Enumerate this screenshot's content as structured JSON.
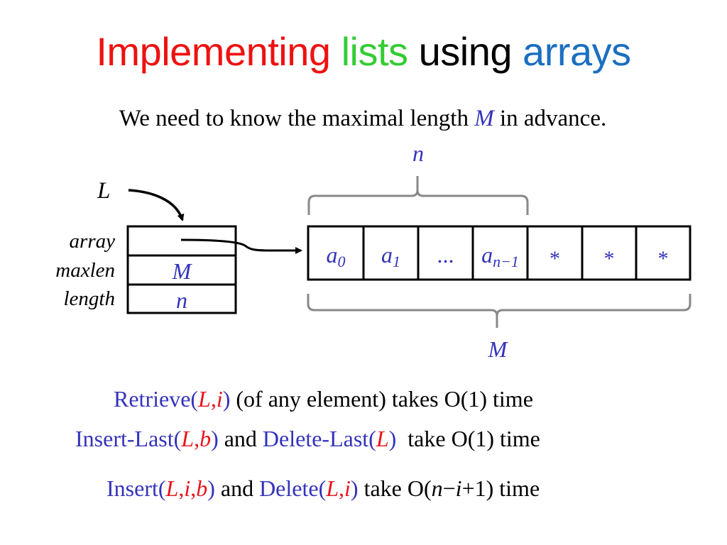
{
  "title": {
    "parts": [
      {
        "text": "Implementing",
        "color": "#ee1111"
      },
      {
        "text": "lists",
        "color": "#33cc33"
      },
      {
        "text": "using",
        "color": "#000000"
      },
      {
        "text": "arrays",
        "color": "#1a6fc0"
      }
    ]
  },
  "subtitle": {
    "before": "We need to know the maximal length ",
    "var": "M",
    "after": " in advance."
  },
  "pointer_label": "L",
  "struct": {
    "fields": [
      {
        "label": "array",
        "value": ""
      },
      {
        "label": "maxlen",
        "value": "M"
      },
      {
        "label": "length",
        "value": "n"
      }
    ]
  },
  "array_cells": [
    {
      "base": "a",
      "sub": "0"
    },
    {
      "base": "a",
      "sub": "1"
    },
    {
      "base": "...",
      "sub": ""
    },
    {
      "base": "a",
      "sub": "n−1"
    },
    {
      "base": "*",
      "sub": ""
    },
    {
      "base": "*",
      "sub": ""
    },
    {
      "base": "*",
      "sub": ""
    }
  ],
  "braces": {
    "top_label": "n",
    "bottom_label": "M"
  },
  "operations": [
    {
      "segments": [
        {
          "text": "Retrieve(",
          "cls": "blue"
        },
        {
          "text": "L",
          "cls": "red it"
        },
        {
          "text": ",",
          "cls": "red"
        },
        {
          "text": "i",
          "cls": "red it"
        },
        {
          "text": ")",
          "cls": "blue"
        },
        {
          "text": " (of any element) takes O(1) time",
          "cls": "black"
        }
      ]
    },
    {
      "segments": [
        {
          "text": "Insert-Last(",
          "cls": "blue"
        },
        {
          "text": "L",
          "cls": "red it"
        },
        {
          "text": ",",
          "cls": "red"
        },
        {
          "text": "b",
          "cls": "red it"
        },
        {
          "text": ")",
          "cls": "blue"
        },
        {
          "text": " and ",
          "cls": "black"
        },
        {
          "text": "Delete-Last(",
          "cls": "blue"
        },
        {
          "text": "L",
          "cls": "red it"
        },
        {
          "text": ")",
          "cls": "blue"
        },
        {
          "text": "  take O(1) time",
          "cls": "black"
        }
      ]
    },
    {
      "segments": [
        {
          "text": "Insert(",
          "cls": "blue"
        },
        {
          "text": "L",
          "cls": "red it"
        },
        {
          "text": ",",
          "cls": "red"
        },
        {
          "text": "i",
          "cls": "red it"
        },
        {
          "text": ",",
          "cls": "red"
        },
        {
          "text": "b",
          "cls": "red it"
        },
        {
          "text": ")",
          "cls": "blue"
        },
        {
          "text": " and ",
          "cls": "black"
        },
        {
          "text": "Delete(",
          "cls": "blue"
        },
        {
          "text": "L",
          "cls": "red it"
        },
        {
          "text": ",",
          "cls": "red"
        },
        {
          "text": "i",
          "cls": "red it"
        },
        {
          "text": ")",
          "cls": "blue"
        },
        {
          "text": " take O(",
          "cls": "black"
        },
        {
          "text": "n",
          "cls": "black it"
        },
        {
          "text": "−",
          "cls": "black"
        },
        {
          "text": "i",
          "cls": "black it"
        },
        {
          "text": "+1) time",
          "cls": "black"
        }
      ]
    }
  ]
}
